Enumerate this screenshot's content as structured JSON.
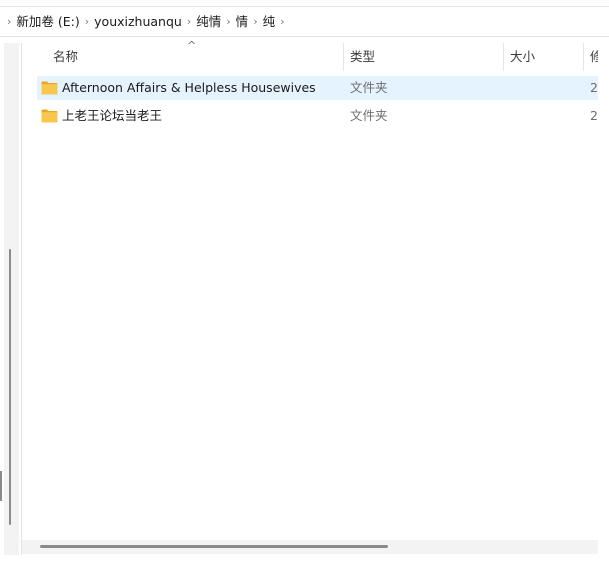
{
  "breadcrumb": {
    "leading_chevron": "›",
    "separator": "›",
    "items": [
      "新加卷 (E:)",
      "youxizhuanqu",
      "纯情",
      "情",
      "纯"
    ],
    "trailing_chevron": "›"
  },
  "columns": {
    "name": "名称",
    "type": "类型",
    "size": "大小",
    "modified": "修",
    "sort_indicator": "^"
  },
  "rows": [
    {
      "name": "Afternoon Affairs & Helpless Housewives",
      "type": "文件夹",
      "size": "",
      "modified": "2",
      "selected": true,
      "icon": "folder-icon"
    },
    {
      "name": "上老王论坛当老王",
      "type": "文件夹",
      "size": "",
      "modified": "2",
      "selected": false,
      "icon": "folder-icon"
    }
  ],
  "colors": {
    "selection": "#e5f3ff",
    "folder": "#f8c74e",
    "folder_tab": "#e8a92b"
  }
}
